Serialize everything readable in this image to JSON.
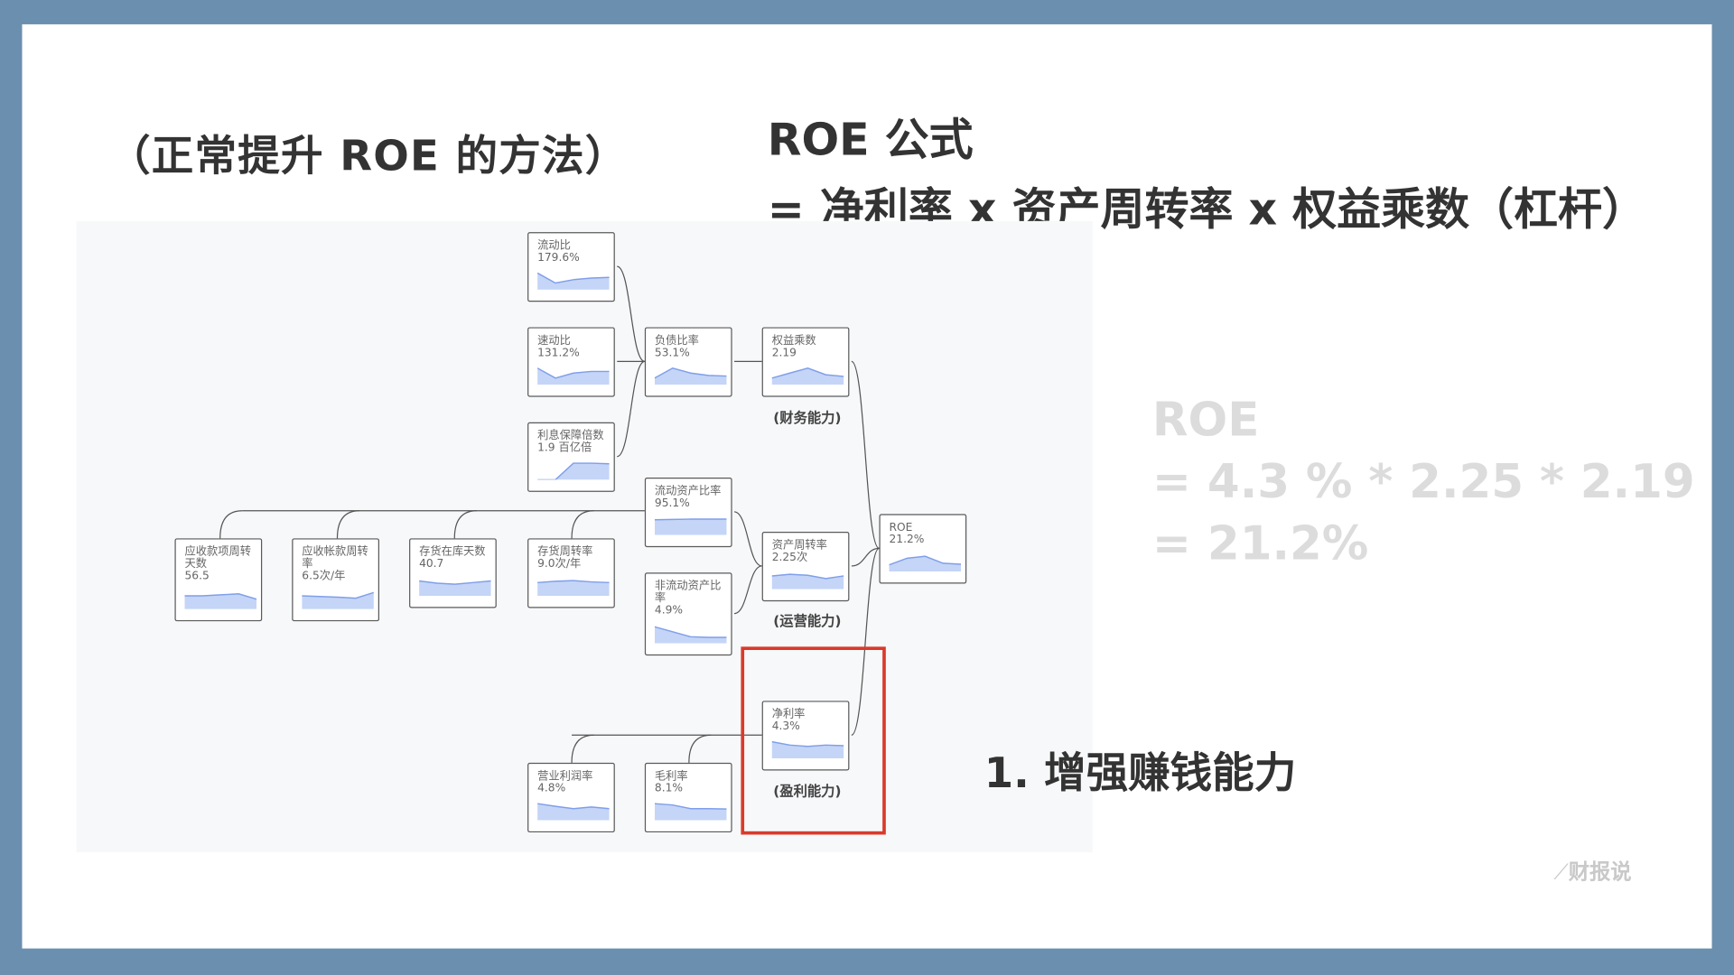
{
  "slide": {
    "title_left": "（正常提升 ROE 的方法）",
    "formula_title": "ROE 公式",
    "formula_line": "= 净利率 x 资产周转率 x 权益乘数（杠杆）",
    "calc": [
      "ROE",
      "= 4.3 % * 2.25 * 2.19",
      "= 21.2%"
    ],
    "step": "1. 增强赚钱能力",
    "logo": "财报说"
  },
  "colors": {
    "frame": "#6b8fae",
    "highlight": "#d93a2b",
    "spark_fill": "#c5d5f7",
    "spark_line": "#7f9fea",
    "calc_text": "#dcdcdc"
  },
  "diagram": {
    "groups": {
      "finance": "(财务能力)",
      "operation": "(运营能力)",
      "profit": "(盈利能力)"
    },
    "nodes": [
      {
        "id": "current_ratio",
        "label": "流动比",
        "value": "179.6%",
        "trend": [
          5,
          2,
          3,
          3.5,
          3.7
        ]
      },
      {
        "id": "quick_ratio",
        "label": "速动比",
        "value": "131.2%",
        "trend": [
          5,
          2,
          3.5,
          4,
          4
        ]
      },
      {
        "id": "interest_cover",
        "label": "利息保障倍数",
        "value": "1.9 百亿倍",
        "trend": [
          0,
          0,
          5,
          5,
          4.8
        ]
      },
      {
        "id": "debt_ratio",
        "label": "负债比率",
        "value": "53.1%",
        "trend": [
          2,
          5,
          3.5,
          2.8,
          2.6
        ]
      },
      {
        "id": "equity_mult",
        "label": "权益乘数",
        "value": "2.19",
        "trend": [
          2,
          3.5,
          5,
          3,
          2.5
        ]
      },
      {
        "id": "cur_asset_ratio",
        "label": "流动资产比率",
        "value": "95.1%",
        "trend": [
          4.6,
          4.7,
          4.8,
          4.8,
          4.8
        ]
      },
      {
        "id": "noncur_asset_ratio",
        "label": "非流动资产比率",
        "value": "4.9%",
        "trend": [
          5,
          3.5,
          2,
          1.8,
          1.8
        ]
      },
      {
        "id": "asset_turnover",
        "label": "资产周转率",
        "value": "2.25次",
        "trend": [
          4,
          4.5,
          4.2,
          3.2,
          4
        ]
      },
      {
        "id": "roe",
        "label": "ROE",
        "value": "21.2%",
        "trend": [
          2,
          4,
          4.6,
          2.5,
          2.2
        ]
      },
      {
        "id": "recv_days",
        "label": "应收款项周转天数",
        "value": "56.5",
        "trend": [
          4,
          4,
          4.3,
          4.6,
          3
        ]
      },
      {
        "id": "recv_turnover",
        "label": "应收帐款周转率",
        "value": "6.5次/年",
        "trend": [
          4,
          3.8,
          3.6,
          3.3,
          5
        ]
      },
      {
        "id": "inv_days",
        "label": "存货在库天数",
        "value": "40.7",
        "trend": [
          4.5,
          3.8,
          3.5,
          4,
          4.5
        ]
      },
      {
        "id": "inv_turnover",
        "label": "存货周转率",
        "value": "9.0次/年",
        "trend": [
          4,
          4.4,
          4.6,
          4.2,
          4
        ]
      },
      {
        "id": "net_margin",
        "label": "净利率",
        "value": "4.3%",
        "trend": [
          5,
          4,
          3.6,
          4,
          3.8
        ]
      },
      {
        "id": "op_margin",
        "label": "营业利润率",
        "value": "4.8%",
        "trend": [
          5,
          4.2,
          3.5,
          4,
          3.5
        ]
      },
      {
        "id": "gross_margin",
        "label": "毛利率",
        "value": "8.1%",
        "trend": [
          5,
          4.6,
          3.5,
          3.5,
          3.4
        ]
      }
    ]
  }
}
